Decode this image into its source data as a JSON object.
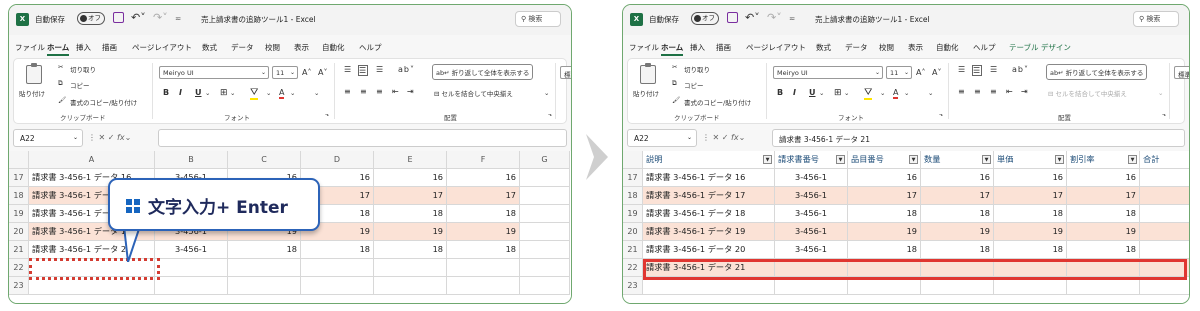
{
  "app": {
    "autosave_label": "自動保存",
    "autosave_state": "オフ",
    "window_title": "売上請求書の追跡ツール1 - Excel",
    "search_label": "検索",
    "excel_icon": "X"
  },
  "tabs": [
    "ファイル",
    "ホーム",
    "挿入",
    "描画",
    "ページレイアウト",
    "数式",
    "データ",
    "校閲",
    "表示",
    "自動化",
    "ヘルプ"
  ],
  "tab_extra": "テーブル デザイン",
  "ribbon": {
    "paste": "貼り付け",
    "cut": "切り取り",
    "copy": "コピー",
    "format_painter": "書式のコピー/貼り付け",
    "clipboard_group": "クリップボード",
    "font_name": "Meiryo UI",
    "font_size": "11",
    "font_group": "フォント",
    "wrap_text": "折り返して全体を表示する",
    "merge_center": "セルを結合して中央揃え",
    "alignment_group": "配置",
    "standard": "標準"
  },
  "left": {
    "name_box": "A22",
    "formula": "",
    "columns": [
      "A",
      "B",
      "C",
      "D",
      "E",
      "F",
      "G"
    ],
    "rows": [
      {
        "num": "16",
        "cells": [
          "",
          "",
          "",
          "",
          "",
          "",
          ""
        ]
      },
      {
        "num": "17",
        "cells": [
          "請求書 3-456-1 データ 16",
          "3-456-1",
          "16",
          "16",
          "16",
          "16",
          ""
        ]
      },
      {
        "num": "18",
        "cells": [
          "請求書 3-456-1 データ 17",
          "3-456-1",
          "17",
          "17",
          "17",
          "17",
          ""
        ]
      },
      {
        "num": "19",
        "cells": [
          "請求書 3-456-1 データ 18",
          "3-456-1",
          "18",
          "18",
          "18",
          "18",
          ""
        ]
      },
      {
        "num": "20",
        "cells": [
          "請求書 3-456-1 データ 19",
          "3-456-1",
          "19",
          "19",
          "19",
          "19",
          ""
        ]
      },
      {
        "num": "21",
        "cells": [
          "請求書 3-456-1 データ 20",
          "3-456-1",
          "18",
          "18",
          "18",
          "18",
          ""
        ]
      },
      {
        "num": "22",
        "cells": [
          "",
          "",
          "",
          "",
          "",
          "",
          ""
        ]
      },
      {
        "num": "23",
        "cells": [
          "",
          "",
          "",
          "",
          "",
          "",
          ""
        ]
      }
    ]
  },
  "right": {
    "name_box": "A22",
    "formula": "請求書 3-456-1 データ 21",
    "table_headers": [
      "説明",
      "請求書番号",
      "品目番号",
      "数量",
      "単価",
      "割引率",
      "合計"
    ],
    "rows": [
      {
        "num": "16",
        "cells": [
          "",
          "",
          "",
          "",
          "",
          "",
          ""
        ]
      },
      {
        "num": "17",
        "cells": [
          "請求書 3-456-1 データ 16",
          "3-456-1",
          "16",
          "16",
          "16",
          "16",
          ""
        ]
      },
      {
        "num": "18",
        "cells": [
          "請求書 3-456-1 データ 17",
          "3-456-1",
          "17",
          "17",
          "17",
          "17",
          ""
        ]
      },
      {
        "num": "19",
        "cells": [
          "請求書 3-456-1 データ 18",
          "3-456-1",
          "18",
          "18",
          "18",
          "18",
          ""
        ]
      },
      {
        "num": "20",
        "cells": [
          "請求書 3-456-1 データ 19",
          "3-456-1",
          "19",
          "19",
          "19",
          "19",
          ""
        ]
      },
      {
        "num": "21",
        "cells": [
          "請求書 3-456-1 データ 20",
          "3-456-1",
          "18",
          "18",
          "18",
          "18",
          ""
        ]
      },
      {
        "num": "22",
        "cells": [
          "請求書 3-456-1 データ 21",
          "",
          "",
          "",
          "",
          "",
          ""
        ]
      },
      {
        "num": "23",
        "cells": [
          "",
          "",
          "",
          "",
          "",
          "",
          ""
        ]
      }
    ]
  },
  "callout": {
    "text": "文字入力+ Enter"
  },
  "colors": {
    "accent_green": "#1e7145",
    "band_fill": "#fbe2d6",
    "selection_red": "#e03631",
    "callout_blue": "#2c63b8"
  }
}
